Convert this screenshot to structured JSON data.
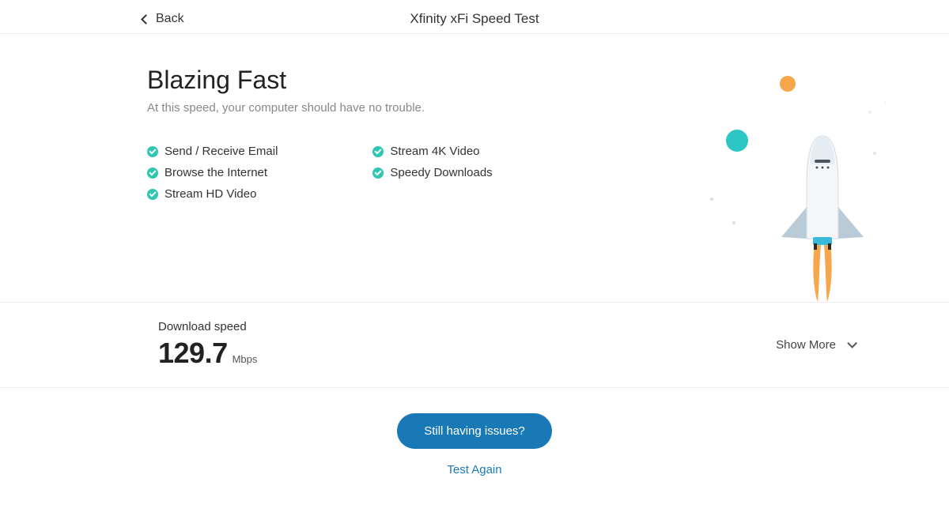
{
  "header": {
    "back_label": "Back",
    "page_title": "Xfinity xFi Speed Test"
  },
  "hero": {
    "title": "Blazing Fast",
    "subtitle": "At this speed, your computer should have no trouble.",
    "capabilities_left": [
      "Send / Receive Email",
      "Browse the Internet",
      "Stream HD Video"
    ],
    "capabilities_right": [
      "Stream 4K Video",
      "Speedy Downloads"
    ]
  },
  "speed": {
    "label": "Download speed",
    "value": "129.7",
    "unit": "Mbps",
    "show_more_label": "Show More"
  },
  "actions": {
    "primary_label": "Still having issues?",
    "secondary_label": "Test Again"
  },
  "colors": {
    "accent_teal": "#2fc7b2",
    "primary_blue": "#1979b7",
    "orange": "#f6a64b",
    "planet_teal": "#2cc6c4"
  }
}
